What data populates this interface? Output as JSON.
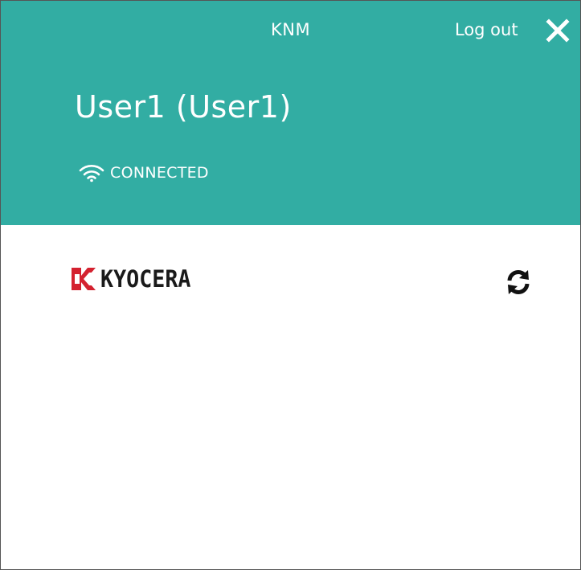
{
  "header": {
    "app_title": "KNM",
    "logout_label": "Log out",
    "close_icon": "close-icon",
    "user_display": "User1 (User1)",
    "status_icon": "wifi-icon",
    "status_text": "CONNECTED",
    "background_color": "#32ada3"
  },
  "content": {
    "brand_name": "KYOCERA",
    "brand_color": "#d4212f",
    "refresh_icon": "refresh-icon"
  }
}
